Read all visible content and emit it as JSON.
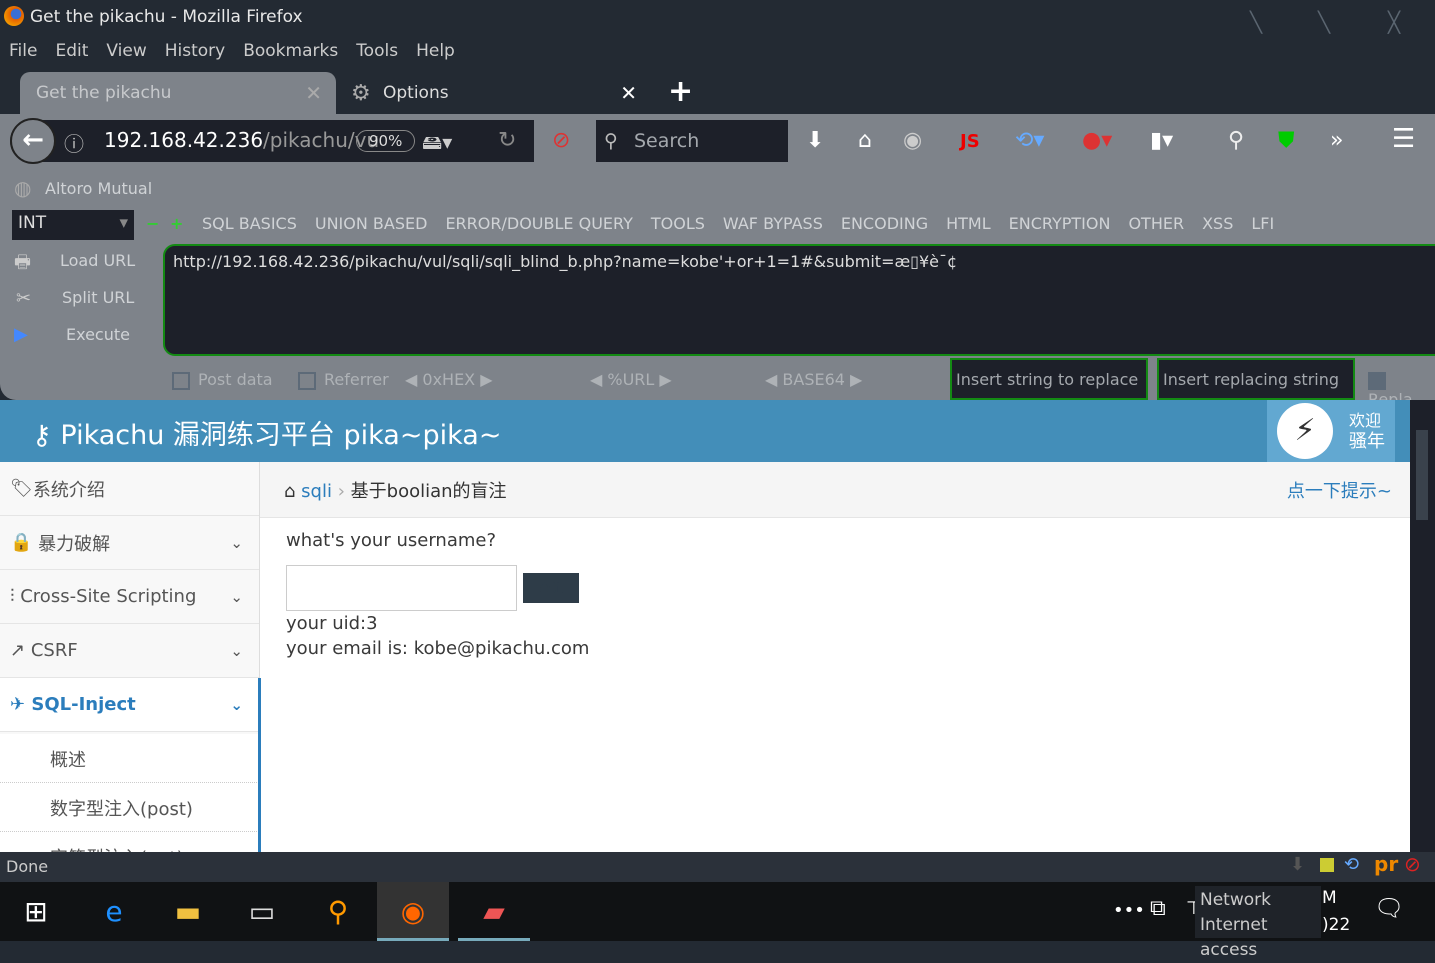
{
  "window": {
    "title": "Get the pikachu - Mozilla Firefox"
  },
  "menu": [
    "File",
    "Edit",
    "View",
    "History",
    "Bookmarks",
    "Tools",
    "Help"
  ],
  "tabs": [
    {
      "label": "Get the pikachu",
      "active": true
    },
    {
      "label": "Options",
      "active": false
    }
  ],
  "navbar": {
    "url_host": "192.168.42.236",
    "url_path": "/pikachu/vu",
    "zoom": "90%",
    "search_placeholder": "Search",
    "toolbar_js_label": "JS"
  },
  "bookmarks": [
    {
      "label": "Altoro Mutual"
    }
  ],
  "hackbar": {
    "select_value": "INT",
    "menus": [
      "SQL BASICS",
      "UNION BASED",
      "ERROR/DOUBLE QUERY",
      "TOOLS",
      "WAF BYPASS",
      "ENCODING",
      "HTML",
      "ENCRYPTION",
      "OTHER",
      "XSS",
      "LFI"
    ],
    "actions": [
      "Load URL",
      "Split URL",
      "Execute"
    ],
    "url_value": "http://192.168.42.236/pikachu/vul/sqli/sqli_blind_b.php?name=kobe'+or+1=1#&submit=æ▯¥è¯¢",
    "options": {
      "post_data": "Post data",
      "referrer": "Referrer",
      "hex": "0xHEX",
      "url": "%URL",
      "base64": "BASE64"
    },
    "replace_placeholder": "Insert string to replace",
    "replacing_placeholder": "Insert replacing string",
    "replace_all": "Repla"
  },
  "page": {
    "brand": "Pikachu 漏洞练习平台 pika~pika~",
    "welcome_line1": "欢迎",
    "welcome_line2": "骚年",
    "sidebar": [
      {
        "label": "系统介绍"
      },
      {
        "label": "暴力破解"
      },
      {
        "label": "Cross-Site Scripting"
      },
      {
        "label": "CSRF"
      },
      {
        "label": "SQL-Inject",
        "active": true
      }
    ],
    "submenu": [
      "概述",
      "数字型注入(post)",
      "字符型注入(get)"
    ],
    "breadcrumb": {
      "parent": "sqli",
      "current": "基于boolian的盲注",
      "hint": "点一下提示~"
    },
    "question": "what's your username?",
    "input_value": "",
    "submit_label": "查询",
    "result_uid": "your uid:3",
    "result_email": "your email is: kobe@pikachu.com",
    "accent": "#438eb9"
  },
  "status": {
    "text": "Done"
  },
  "taskbar": {
    "tooltip_line1": "Network",
    "tooltip_line2": "Internet access",
    "clock_partial_1": "M",
    "clock_partial_2": ")22"
  }
}
